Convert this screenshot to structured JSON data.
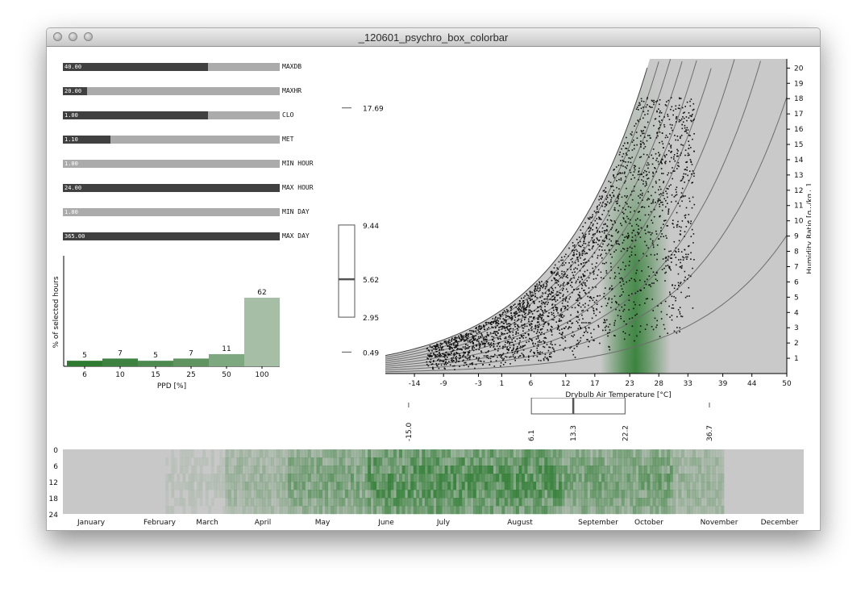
{
  "window": {
    "title": "_120601_psychro_box_colorbar"
  },
  "sliders": [
    {
      "value_label": "40.00",
      "name": "MAXDB",
      "fraction": 0.67
    },
    {
      "value_label": "20.00",
      "name": "MAXHR",
      "fraction": 0.11
    },
    {
      "value_label": "1.00",
      "name": "CLO",
      "fraction": 0.67
    },
    {
      "value_label": "1.10",
      "name": "MET",
      "fraction": 0.22
    },
    {
      "value_label": "1.00",
      "name": "MIN HOUR",
      "fraction": 0.0
    },
    {
      "value_label": "24.00",
      "name": "MAX HOUR",
      "fraction": 1.0
    },
    {
      "value_label": "1.00",
      "name": "MIN DAY",
      "fraction": 0.0
    },
    {
      "value_label": "365.00",
      "name": "MAX DAY",
      "fraction": 1.0
    }
  ],
  "ppd_hist": {
    "ylabel": "% of selected hours",
    "xlabel": "PPD [%]",
    "categories": [
      "6",
      "10",
      "15",
      "25",
      "50",
      "100"
    ],
    "values": [
      5,
      7,
      5,
      7,
      11,
      62
    ],
    "colors": [
      "#2e7a31",
      "#3d8240",
      "#4c8a4f",
      "#5f9460",
      "#7ea87f",
      "#a6bea6"
    ]
  },
  "vbox": {
    "top_label": "17.69",
    "q3_label": "9.44",
    "median_label": "5.62",
    "q1_label": "2.95",
    "bottom_label": "0.49"
  },
  "psychro": {
    "x_ticks": [
      "-14",
      "-9",
      "-3",
      "1",
      "6",
      "12",
      "17",
      "23",
      "28",
      "33",
      "39",
      "44",
      "50"
    ],
    "y_ticks": [
      "1",
      "2",
      "3",
      "4",
      "5",
      "6",
      "7",
      "8",
      "9",
      "10",
      "11",
      "12",
      "13",
      "14",
      "15",
      "16",
      "17",
      "18",
      "19",
      "20"
    ],
    "xlabel": "Drybulb Air Temperature [°C]",
    "ylabel_main": "Humidity Ratio [g",
    "ylabel_sub1": "W",
    "ylabel_mid": "/kg",
    "ylabel_sub2": "da",
    "ylabel_end": "]"
  },
  "hbox": {
    "min_label": "-15.0",
    "q1_label": "6.1",
    "median_label": "13.3",
    "q3_label": "22.2",
    "max_label": "36.7"
  },
  "heatmap": {
    "hour_labels": [
      "0",
      "6",
      "12",
      "18",
      "24"
    ],
    "months": [
      "January",
      "February",
      "March",
      "April",
      "May",
      "June",
      "July",
      "August",
      "September",
      "October",
      "November",
      "December"
    ],
    "base_color": "#c8c8c8",
    "green_color": "#2e7d32"
  },
  "chart_data": [
    {
      "type": "bar",
      "title": "",
      "xlabel": "PPD [%]",
      "ylabel": "% of selected hours",
      "categories": [
        "6",
        "10",
        "15",
        "25",
        "50",
        "100"
      ],
      "values": [
        5,
        7,
        5,
        7,
        11,
        62
      ]
    },
    {
      "type": "scatter",
      "title": "",
      "xlabel": "Drybulb Air Temperature [°C]",
      "ylabel": "Humidity Ratio [gW/kgda]",
      "xlim": [
        -19,
        50
      ],
      "ylim": [
        0,
        20
      ],
      "comfort_band_x": [
        18,
        30
      ],
      "summary": {
        "x_box": {
          "min": -15.0,
          "q1": 6.1,
          "median": 13.3,
          "q3": 22.2,
          "max": 36.7
        },
        "y_box": {
          "min": 0.49,
          "q1": 2.95,
          "median": 5.62,
          "q3": 9.44,
          "max": 17.69
        }
      }
    }
  ]
}
